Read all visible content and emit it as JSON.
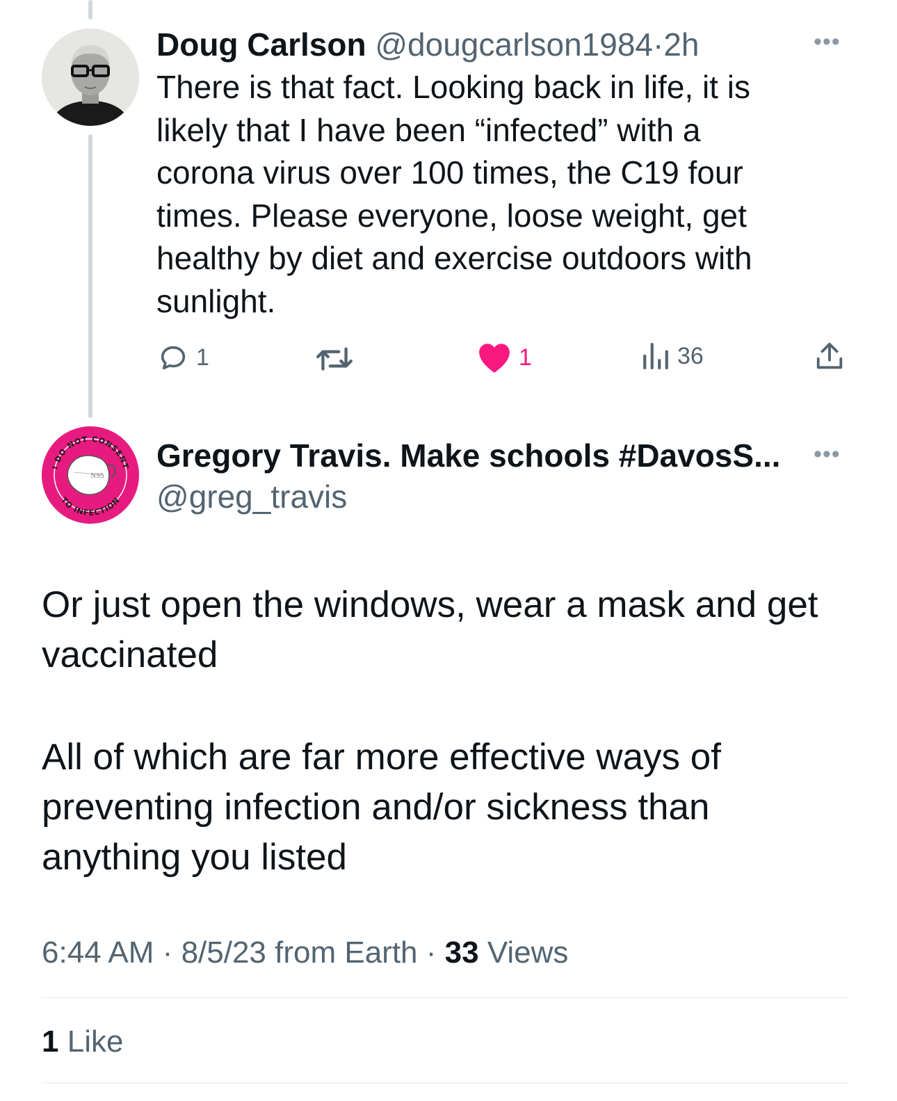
{
  "tweet1": {
    "author_name": "Doug Carlson",
    "author_handle": "@dougcarlson1984",
    "separator": "·",
    "time_ago": "2h",
    "text_lines": [
      "There is that fact.  Looking back in life, it is",
      "likely that I have been “infected” with a",
      "corona virus over 100 times, the C19 four",
      "times.  Please everyone, loose weight, get",
      "healthy by diet and exercise outdoors with",
      "sunlight."
    ],
    "actions": {
      "reply_count": "1",
      "retweet_count": "",
      "like_count": "1",
      "views_count": "36"
    }
  },
  "tweet2": {
    "author_name": "Gregory Travis. Make schools #DavosS...",
    "author_handle": "@greg_travis",
    "avatar_text": {
      "top": "I DO NOT CONSENT",
      "bottom": "TO INFECTION",
      "mask": "N95"
    },
    "paragraph1": [
      "Or just open the windows, wear a mask and get",
      "vaccinated"
    ],
    "paragraph2": [
      "All of which are far more effective ways of",
      "preventing infection and/or sickness than",
      "anything you listed"
    ],
    "meta": {
      "time": "6:44 AM",
      "sep1": "·",
      "date_source": "8/5/23 from Earth",
      "sep2": "·",
      "views_count": "33",
      "views_label": "Views"
    },
    "likes": {
      "count": "1",
      "label": "Like"
    }
  },
  "colors": {
    "text": "#0f1419",
    "muted": "#536471",
    "like_pink": "#f91880",
    "thread_line": "#cfd9de",
    "avatar2_brand": "#e71b7f"
  },
  "icons": [
    "reply-icon",
    "retweet-icon",
    "like-icon",
    "views-icon",
    "share-icon",
    "more-icon"
  ]
}
